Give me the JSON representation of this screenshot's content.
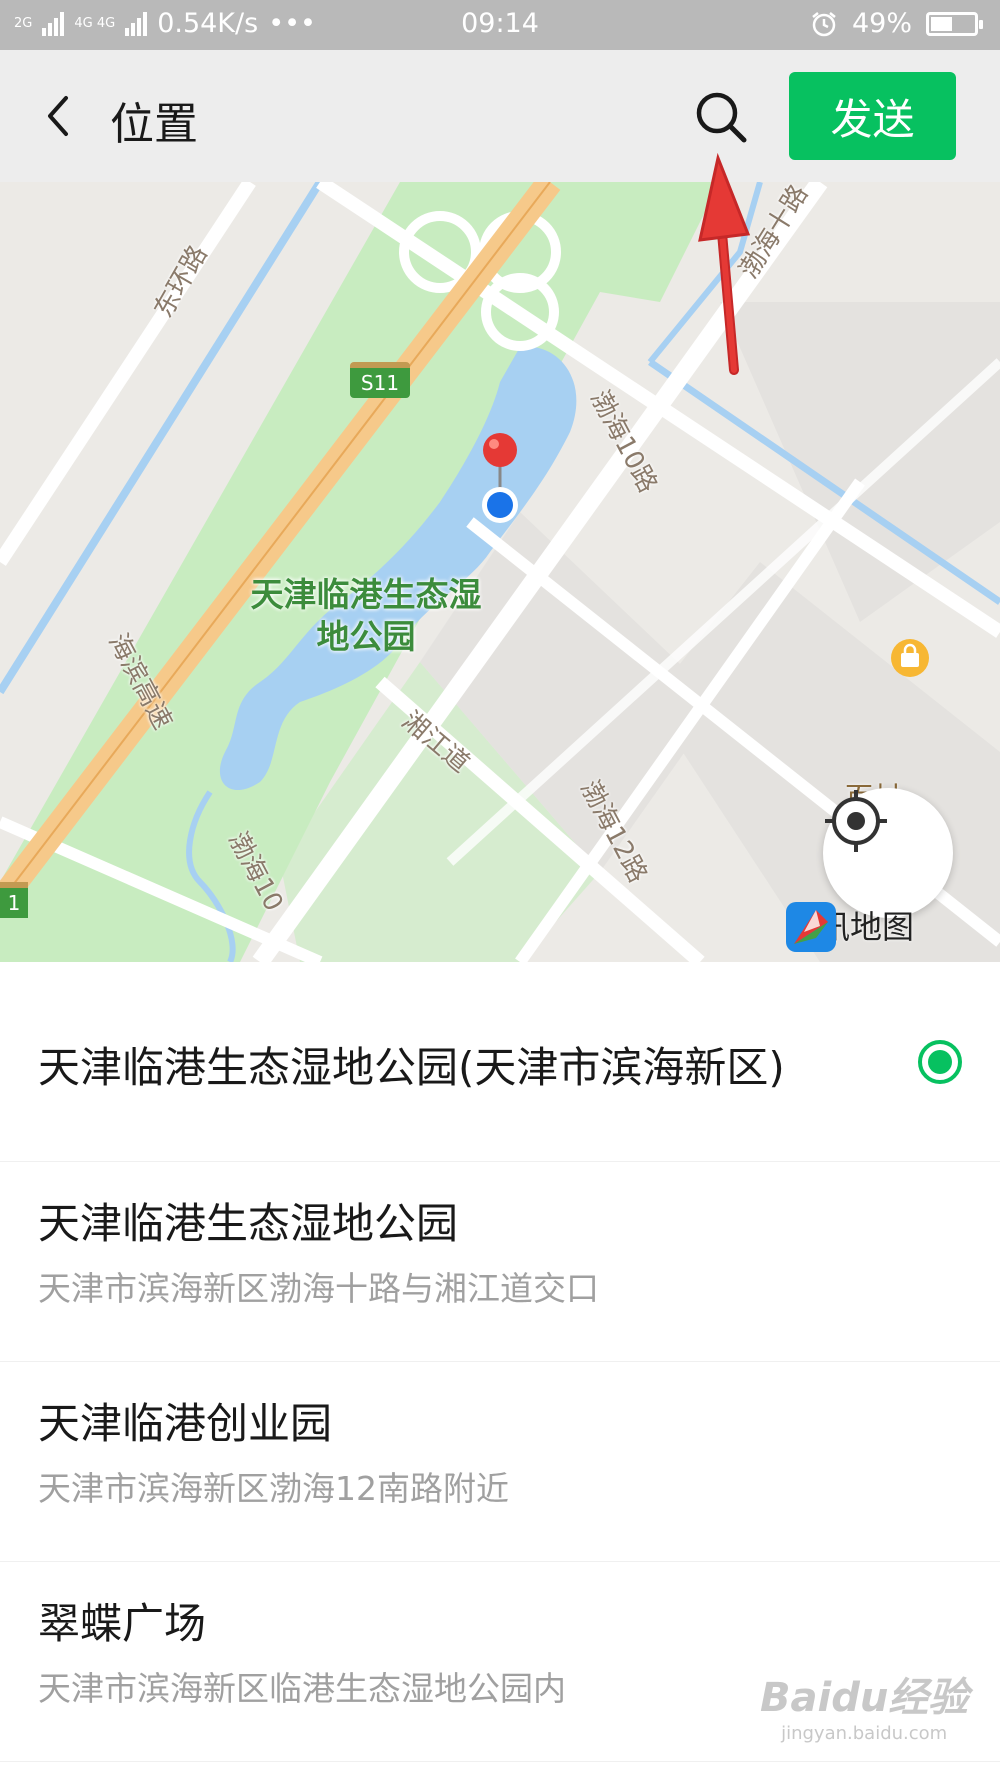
{
  "status_bar": {
    "network_left": "2G",
    "network_right": "4G 4G",
    "speed": "0.54K/s",
    "more": "•••",
    "time": "09:14",
    "battery": "49%",
    "battery_level": 0.49,
    "icons": [
      "signal-icon",
      "alarm-icon",
      "battery-icon"
    ]
  },
  "header": {
    "title": "位置",
    "send_label": "发送",
    "accent": "#07c160",
    "icons": [
      "back-icon",
      "search-icon"
    ]
  },
  "map": {
    "park_name": "天津临港生态湿地公园",
    "roads": [
      "东环路",
      "渤海十路",
      "渤海10路",
      "海滨高速",
      "湘江道",
      "渤海12路",
      "渤海10"
    ],
    "shields": [
      "S11",
      "1"
    ],
    "shop_label": "百材",
    "provider": "腾讯地图",
    "pin_color": "#e53935",
    "icons": [
      "location-pin-icon",
      "my-location-icon",
      "tencent-map-logo-icon",
      "shop-icon"
    ]
  },
  "locations": [
    {
      "name": "天津临港生态湿地公园(天津市滨海新区)",
      "address": "",
      "selected": true
    },
    {
      "name": "天津临港生态湿地公园",
      "address": "天津市滨海新区渤海十路与湘江道交口",
      "selected": false
    },
    {
      "name": "天津临港创业园",
      "address": "天津市滨海新区渤海12南路附近",
      "selected": false
    },
    {
      "name": "翠蝶广场",
      "address": "天津市滨海新区临港生态湿地公园内",
      "selected": false
    }
  ],
  "watermark": {
    "main": "Baidu经验",
    "url": "jingyan.baidu.com"
  }
}
